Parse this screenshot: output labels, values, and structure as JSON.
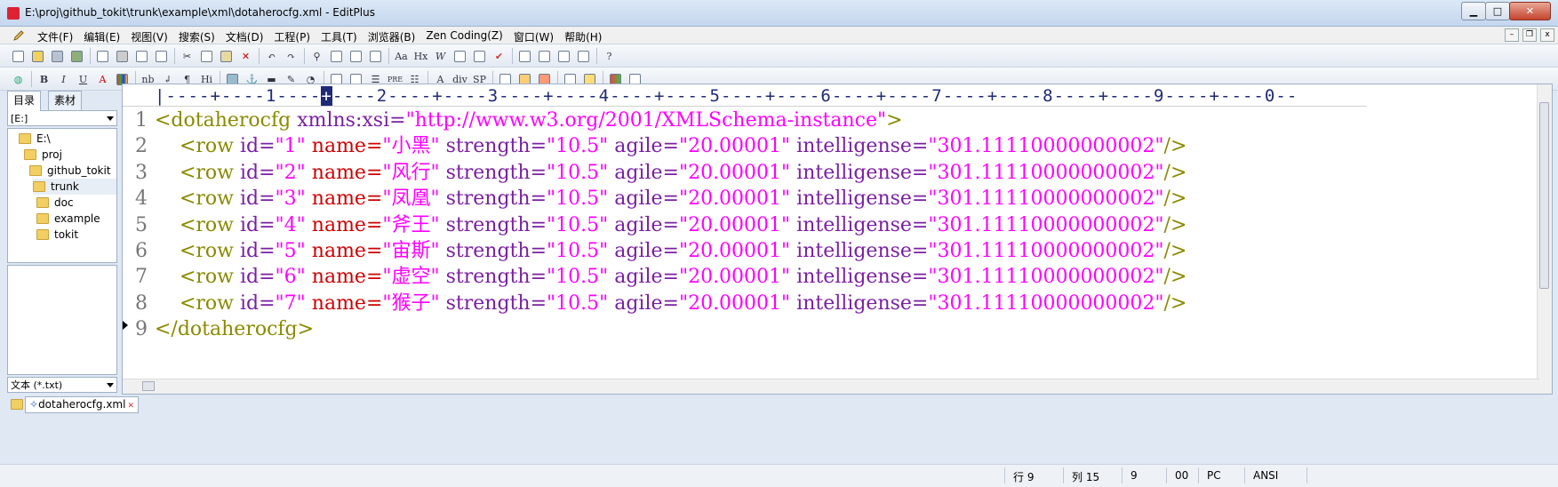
{
  "window": {
    "title": "E:\\proj\\github_tokit\\trunk\\example\\xml\\dotaherocfg.xml - EditPlus",
    "min_glyph": "▁",
    "max_glyph": "□",
    "close_glyph": "✕"
  },
  "menu": {
    "items": [
      "文件(F)",
      "编辑(E)",
      "视图(V)",
      "搜索(S)",
      "文档(D)",
      "工程(P)",
      "工具(T)",
      "浏览器(B)",
      "Zen Coding(Z)",
      "窗口(W)",
      "帮助(H)"
    ],
    "mdi_min": "–",
    "mdi_restore": "❐",
    "mdi_close": "x"
  },
  "toolbar2_labels": {
    "bold": "B",
    "italic": "I",
    "underline": "U",
    "font": "A",
    "nb": "nb",
    "br": "↲",
    "para": "¶",
    "hi": "Hi",
    "pre": "PRE",
    "a": "A",
    "div": "div",
    "sp": "SP"
  },
  "toolbar1_labels": {
    "aa": "Aa",
    "hx": "Hx",
    "w": "W"
  },
  "sidebar": {
    "tabs": [
      "目录",
      "素材"
    ],
    "drive": "[E:]",
    "tree": [
      {
        "label": "E:\\",
        "indent": 0
      },
      {
        "label": "proj",
        "indent": 1
      },
      {
        "label": "github_tokit",
        "indent": 2
      },
      {
        "label": "trunk",
        "indent": 3
      },
      {
        "label": "doc",
        "indent": 4
      },
      {
        "label": "example",
        "indent": 4
      },
      {
        "label": "tokit",
        "indent": 4
      }
    ],
    "filter": "文本 (*.txt)"
  },
  "editor": {
    "ruler_before": "|----+----1----",
    "ruler_cursor": "+",
    "ruler_after": "----2----+----3----+----4----+----5----+----6----+----7----+----8----+----9----+----0--",
    "line_numbers": [
      "1",
      "2",
      "3",
      "4",
      "5",
      "6",
      "7",
      "8",
      "9"
    ],
    "header": {
      "open": "<dotaherocfg",
      "attr": " xmlns:xsi=",
      "value": "\"http://www.w3.org/2001/XMLSchema-instance\"",
      "close": ">"
    },
    "rows": [
      {
        "id": "\"1\"",
        "name": "\"小黑\"",
        "strength": "\"10.5\"",
        "agile": "\"20.00001\"",
        "intelligense": "\"301.11110000000002\""
      },
      {
        "id": "\"2\"",
        "name": "\"风行\"",
        "strength": "\"10.5\"",
        "agile": "\"20.00001\"",
        "intelligense": "\"301.11110000000002\""
      },
      {
        "id": "\"3\"",
        "name": "\"凤凰\"",
        "strength": "\"10.5\"",
        "agile": "\"20.00001\"",
        "intelligense": "\"301.11110000000002\""
      },
      {
        "id": "\"4\"",
        "name": "\"斧王\"",
        "strength": "\"10.5\"",
        "agile": "\"20.00001\"",
        "intelligense": "\"301.11110000000002\""
      },
      {
        "id": "\"5\"",
        "name": "\"宙斯\"",
        "strength": "\"10.5\"",
        "agile": "\"20.00001\"",
        "intelligense": "\"301.11110000000002\""
      },
      {
        "id": "\"6\"",
        "name": "\"虚空\"",
        "strength": "\"10.5\"",
        "agile": "\"20.00001\"",
        "intelligense": "\"301.11110000000002\""
      },
      {
        "id": "\"7\"",
        "name": "\"猴子\"",
        "strength": "\"10.5\"",
        "agile": "\"20.00001\"",
        "intelligense": "\"301.11110000000002\""
      }
    ],
    "row_tokens": {
      "open": "    <row",
      "id_attr": " id=",
      "name_attr": " name=",
      "strength_attr": " strength=",
      "agile_attr": " agile=",
      "intel_attr": " intelligense=",
      "close": "/>"
    },
    "footer": "</dotaherocfg>"
  },
  "doc_tab": {
    "label": "dotaherocfg.xml",
    "mark": "✧",
    "close": "✕"
  },
  "status": {
    "row_label": "行 9",
    "col_label": "列 15",
    "v1": "9",
    "v2": "00",
    "mode": "PC",
    "encoding": "ANSI"
  }
}
